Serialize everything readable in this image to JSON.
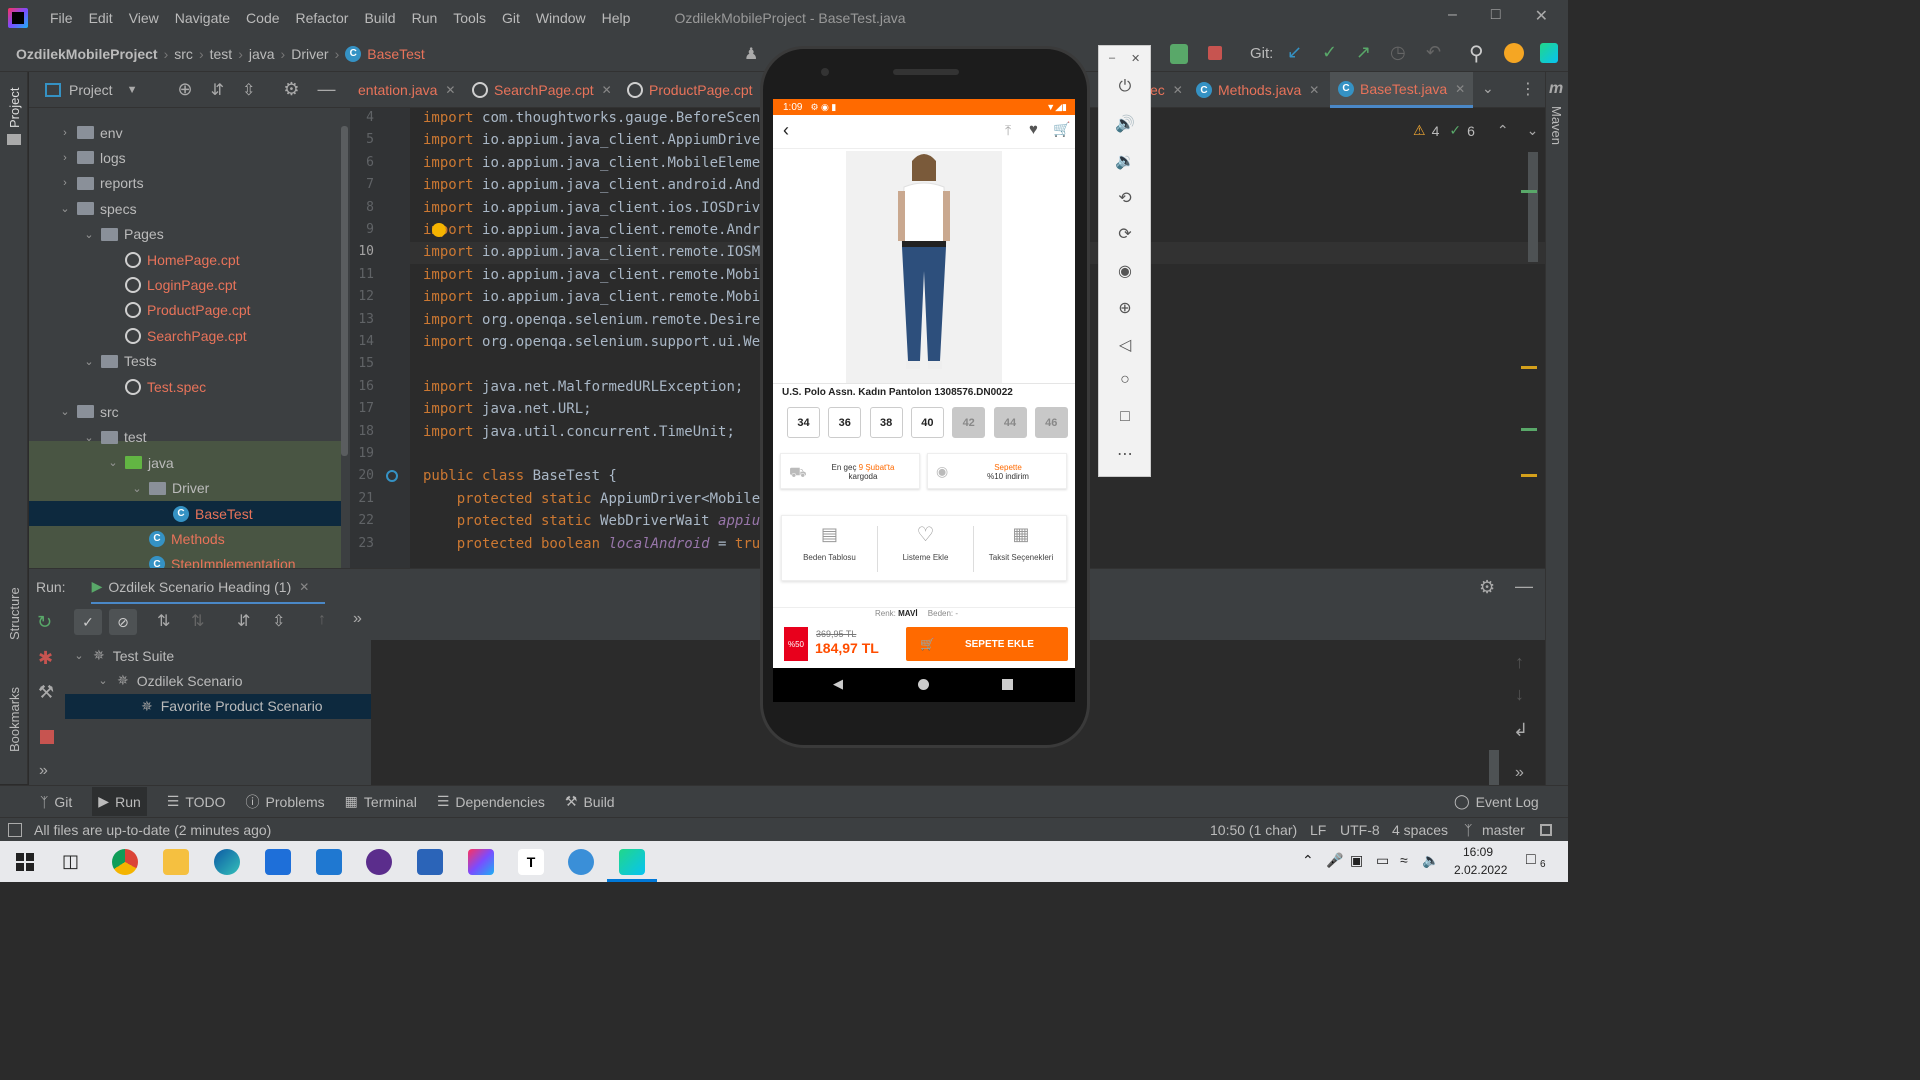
{
  "window": {
    "title": "OzdilekMobileProject - BaseTest.java",
    "menu": [
      "File",
      "Edit",
      "View",
      "Navigate",
      "Code",
      "Refactor",
      "Build",
      "Run",
      "Tools",
      "Git",
      "Window",
      "Help"
    ]
  },
  "breadcrumb": [
    "OzdilekMobileProject",
    "src",
    "test",
    "java",
    "Driver",
    "BaseTest"
  ],
  "toolbar": {
    "git_label": "Git:"
  },
  "project": {
    "title": "Project",
    "tree": [
      {
        "label": "env",
        "kind": "folder",
        "depth": 1,
        "expanded": false
      },
      {
        "label": "logs",
        "kind": "folder",
        "depth": 1,
        "expanded": false
      },
      {
        "label": "reports",
        "kind": "folder",
        "depth": 1,
        "expanded": false
      },
      {
        "label": "specs",
        "kind": "folder",
        "depth": 1,
        "expanded": true
      },
      {
        "label": "Pages",
        "kind": "folder",
        "depth": 2,
        "expanded": true
      },
      {
        "label": "HomePage.cpt",
        "kind": "gauge",
        "depth": 3
      },
      {
        "label": "LoginPage.cpt",
        "kind": "gauge",
        "depth": 3
      },
      {
        "label": "ProductPage.cpt",
        "kind": "gauge",
        "depth": 3
      },
      {
        "label": "SearchPage.cpt",
        "kind": "gauge",
        "depth": 3
      },
      {
        "label": "Tests",
        "kind": "folder",
        "depth": 2,
        "expanded": true
      },
      {
        "label": "Test.spec",
        "kind": "gauge",
        "depth": 3
      },
      {
        "label": "src",
        "kind": "folder",
        "depth": 1,
        "expanded": true
      },
      {
        "label": "test",
        "kind": "folder",
        "depth": 2,
        "expanded": true
      },
      {
        "label": "java",
        "kind": "folder-green",
        "depth": 3,
        "expanded": true
      },
      {
        "label": "Driver",
        "kind": "folder",
        "depth": 4,
        "expanded": true
      },
      {
        "label": "BaseTest",
        "kind": "class",
        "depth": 5,
        "selected": true
      },
      {
        "label": "Methods",
        "kind": "class",
        "depth": 4
      },
      {
        "label": "StepImplementation",
        "kind": "class",
        "depth": 4
      }
    ]
  },
  "editor_tabs": [
    {
      "label": "entation.java"
    },
    {
      "label": "SearchPage.cpt"
    },
    {
      "label": "ProductPage.cpt"
    },
    {
      "label": "ec"
    },
    {
      "label": "Methods.java"
    },
    {
      "label": "BaseTest.java",
      "active": true
    }
  ],
  "inspections": {
    "warnings": "4",
    "ok": "6"
  },
  "code_lines": [
    {
      "n": "4",
      "kw": "import ",
      "rest": "com.thoughtworks.gauge.BeforeScena"
    },
    {
      "n": "5",
      "kw": "import ",
      "rest": "io.appium.java_client.AppiumDriver"
    },
    {
      "n": "6",
      "kw": "import ",
      "rest": "io.appium.java_client.MobileElemen"
    },
    {
      "n": "7",
      "kw": "import ",
      "rest": "io.appium.java_client.android.Andr"
    },
    {
      "n": "8",
      "kw": "import ",
      "rest": "io.appium.java_client.ios.IOSDrive"
    },
    {
      "n": "9",
      "kw": "import ",
      "rest": "io.appium.java_client.remote.Andro"
    },
    {
      "n": "10",
      "kw": "import ",
      "rest": "io.appium.java_client.remote.IOSMo"
    },
    {
      "n": "11",
      "kw": "import ",
      "rest": "io.appium.java_client.remote.Mobil"
    },
    {
      "n": "12",
      "kw": "import ",
      "rest": "io.appium.java_client.remote.Mobil"
    },
    {
      "n": "13",
      "kw": "import ",
      "rest": "org.openqa.selenium.remote.Desired"
    },
    {
      "n": "14",
      "kw": "import ",
      "rest": "org.openqa.selenium.support.ui.Web"
    },
    {
      "n": "15",
      "kw": "",
      "rest": ""
    },
    {
      "n": "16",
      "kw": "import ",
      "rest": "java.net.MalformedURLException;"
    },
    {
      "n": "17",
      "kw": "import ",
      "rest": "java.net.URL;"
    },
    {
      "n": "18",
      "kw": "import ",
      "rest": "java.util.concurrent.TimeUnit;"
    },
    {
      "n": "19",
      "kw": "",
      "rest": ""
    },
    {
      "n": "20",
      "kw": "public class ",
      "rest": "BaseTest {"
    },
    {
      "n": "21",
      "kw": "    protected static ",
      "rest": "AppiumDriver<MobileE"
    },
    {
      "n": "22",
      "kw": "    protected static ",
      "rest": "WebDriverWait ",
      "italic": "appium"
    },
    {
      "n": "23",
      "kw": "    protected boolean ",
      "rest": "",
      "italic": "localAndroid",
      "tail": " = ",
      "kw2": "true"
    }
  ],
  "run": {
    "label": "Run:",
    "config": "Ozdilek Scenario Heading (1)",
    "tree": [
      {
        "label": "Test Suite",
        "depth": 0
      },
      {
        "label": "Ozdilek Scenario",
        "depth": 1
      },
      {
        "label": "Favorite Product Scenario",
        "depth": 2,
        "selected": true
      }
    ]
  },
  "side_labels": {
    "project": "Project",
    "structure": "Structure",
    "bookmarks": "Bookmarks",
    "maven": "Maven"
  },
  "bottom_tools": [
    "Git",
    "Run",
    "TODO",
    "Problems",
    "Terminal",
    "Dependencies",
    "Build"
  ],
  "event_log": "Event Log",
  "status": {
    "message": "All files are up-to-date (2 minutes ago)",
    "position": "10:50 (1 char)",
    "line_sep": "LF",
    "encoding": "UTF-8",
    "indent": "4 spaces",
    "branch": "master"
  },
  "taskbar": {
    "time": "16:09",
    "date": "2.02.2022",
    "notifications": "6"
  },
  "phone": {
    "time": "1:09",
    "product_title": "U.S. Polo Assn. Kadın Pantolon 1308576.DN0022",
    "sizes": [
      {
        "label": "34",
        "available": true
      },
      {
        "label": "36",
        "available": true
      },
      {
        "label": "38",
        "available": true
      },
      {
        "label": "40",
        "available": true
      },
      {
        "label": "42",
        "available": false
      },
      {
        "label": "44",
        "available": false
      },
      {
        "label": "46",
        "available": false
      }
    ],
    "shipping_prefix": "En geç ",
    "shipping_date": "9 Şubat'ta",
    "shipping_suffix": "kargoda",
    "discount_line1": "Sepette",
    "discount_line2": "%10 indirim",
    "actions": [
      "Beden Tablosu",
      "Listeme Ekle",
      "Taksit Seçenekleri"
    ],
    "color_label": "Renk:",
    "color_value": "MAVİ",
    "size_label": "Beden:",
    "size_value": "-",
    "discount_badge": "%50",
    "old_price": "369,95 TL",
    "new_price": "184,97 TL",
    "add_to_cart": "SEPETE EKLE"
  },
  "colors": {
    "accent": "#ff6a00",
    "price": "#ff4d00",
    "badge": "#e8001c"
  }
}
